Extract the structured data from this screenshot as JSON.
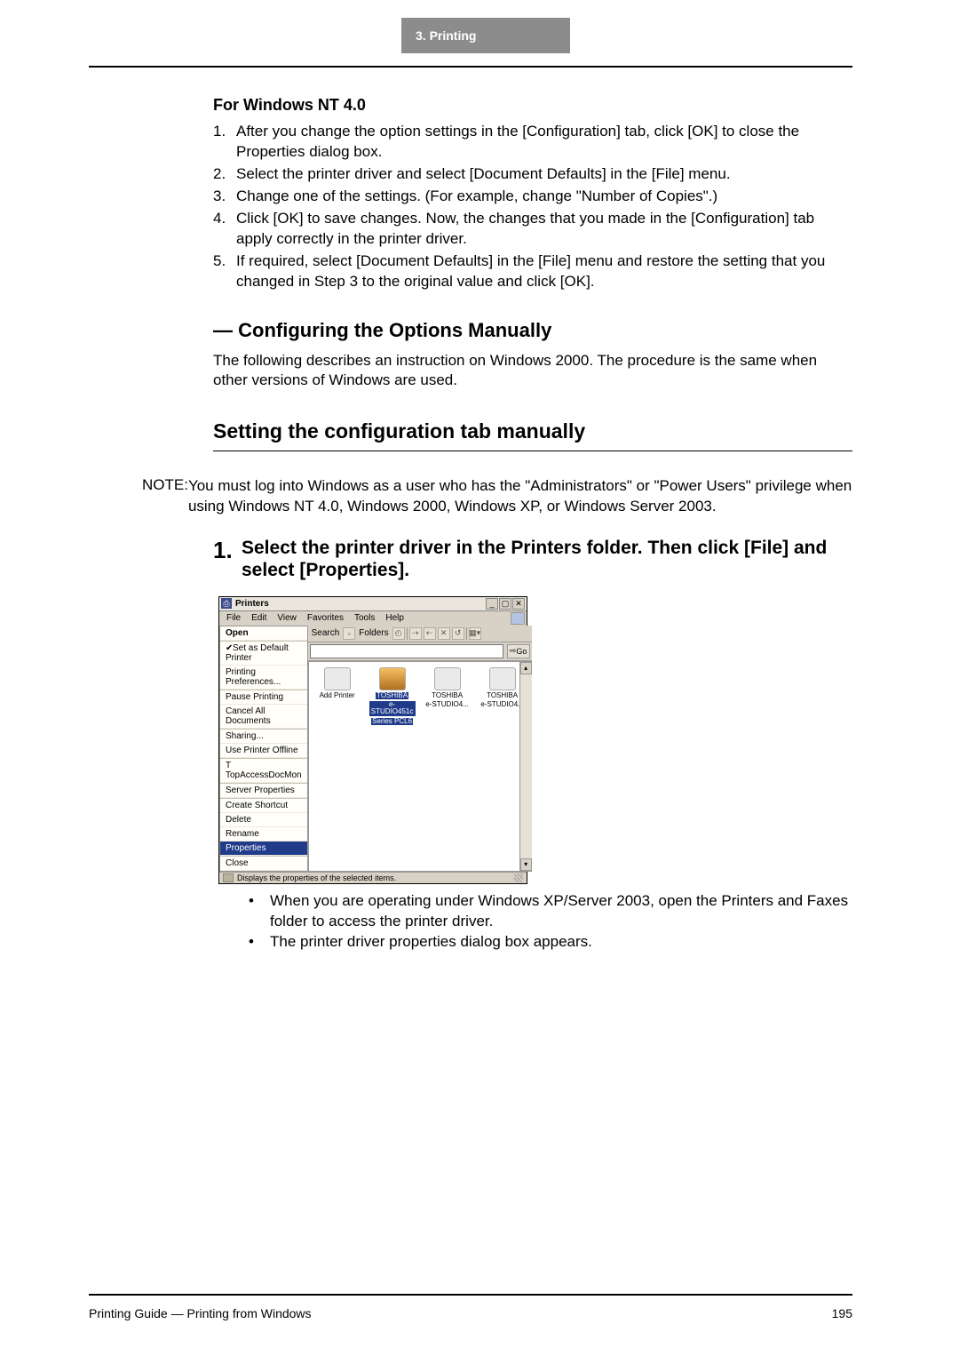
{
  "header": {
    "chapter": "3.  Printing"
  },
  "nt40": {
    "heading": "For Windows NT 4.0",
    "items": [
      "After you change the option settings in the [Configuration] tab, click [OK] to close the Properties dialog box.",
      "Select the printer driver and select [Document Defaults] in the [File] menu.",
      "Change one of the settings. (For example, change \"Number of Copies\".)",
      "Click [OK] to save changes.  Now, the changes that you made in the [Configuration] tab apply correctly in the printer driver.",
      "If required, select [Document Defaults] in the [File] menu and restore the setting that you changed in Step 3 to the original value and click [OK]."
    ]
  },
  "configHeading": "— Configuring the Options Manually",
  "configPara": "The following describes an instruction on Windows 2000.  The procedure is the same when other versions of Windows are used.",
  "sectionTitle": "Setting the configuration tab manually",
  "noteLabel": "NOTE:",
  "noteText": "You must log into Windows as a user who has the \"Administrators\" or \"Power Users\" privilege when using Windows NT 4.0, Windows 2000, Windows XP, or Windows Server 2003.",
  "step1": {
    "num": "1.",
    "text": "Select the printer driver in the Printers folder. Then click [File] and select [Properties]."
  },
  "bullets": [
    "When you are operating under Windows XP/Server 2003, open the Printers and Faxes folder to access the printer driver.",
    "The printer driver properties dialog box appears."
  ],
  "footer": {
    "left": "Printing Guide — Printing from Windows",
    "right": "195"
  },
  "win": {
    "title": "Printers",
    "menus": [
      "File",
      "Edit",
      "View",
      "Favorites",
      "Tools",
      "Help"
    ],
    "toolbar": {
      "search": "Search",
      "folders": "Folders"
    },
    "go": "Go",
    "dropdown": {
      "open": "Open",
      "setDefault": "Set as Default Printer",
      "prefs": "Printing Preferences...",
      "pause": "Pause Printing",
      "cancelAll": "Cancel All Documents",
      "sharing": "Sharing...",
      "offline": "Use Printer Offline",
      "topAccess": "T TopAccessDocMon",
      "serverProps": "Server Properties",
      "createShortcut": "Create Shortcut",
      "delete": "Delete",
      "rename": "Rename",
      "properties": "Properties",
      "close": "Close"
    },
    "icons": {
      "add": "Add Printer",
      "p1a": "TOSHIBA",
      "p1b": "e-STUDIO451c",
      "p1c": "Series PCL6",
      "p2a": "TOSHIBA",
      "p2b": "e-STUDIO4...",
      "p3a": "TOSHIBA",
      "p3b": "e-STUDIO4..."
    },
    "status": "Displays the properties of the selected items."
  }
}
